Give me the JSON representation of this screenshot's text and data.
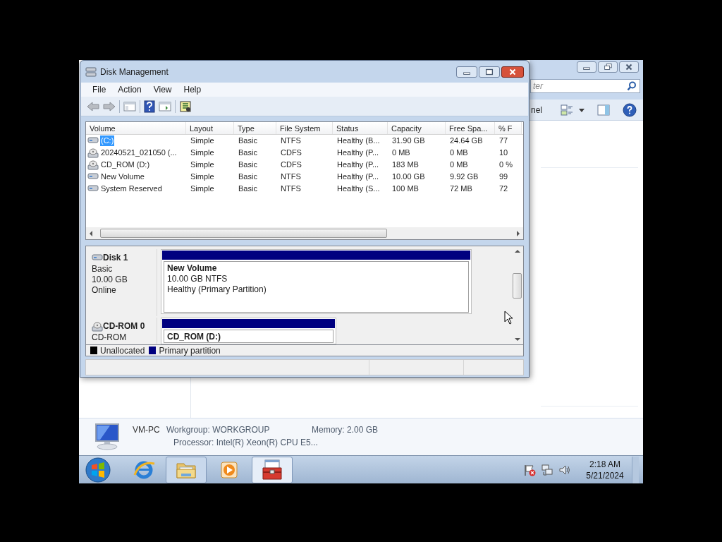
{
  "background_window": {
    "search": {
      "placeholder": "ter"
    },
    "toolbar_label": "nel"
  },
  "window": {
    "title": "Disk Management",
    "menu": [
      "File",
      "Action",
      "View",
      "Help"
    ],
    "volume_list": {
      "columns": [
        "Volume",
        "Layout",
        "Type",
        "File System",
        "Status",
        "Capacity",
        "Free Spa...",
        "% F"
      ],
      "rows": [
        {
          "kind": "disk",
          "selected": true,
          "cells": [
            "(C:)",
            "Simple",
            "Basic",
            "NTFS",
            "Healthy (B...",
            "31.90 GB",
            "24.64 GB",
            "77"
          ]
        },
        {
          "kind": "cd",
          "selected": false,
          "cells": [
            "20240521_021050 (...",
            "Simple",
            "Basic",
            "CDFS",
            "Healthy (P...",
            "0 MB",
            "0 MB",
            "10"
          ]
        },
        {
          "kind": "cd",
          "selected": false,
          "cells": [
            "CD_ROM (D:)",
            "Simple",
            "Basic",
            "CDFS",
            "Healthy (P...",
            "183 MB",
            "0 MB",
            "0 %"
          ]
        },
        {
          "kind": "disk",
          "selected": false,
          "cells": [
            "New Volume",
            "Simple",
            "Basic",
            "NTFS",
            "Healthy (P...",
            "10.00 GB",
            "9.92 GB",
            "99"
          ]
        },
        {
          "kind": "disk",
          "selected": false,
          "cells": [
            "System Reserved",
            "Simple",
            "Basic",
            "NTFS",
            "Healthy (S...",
            "100 MB",
            "72 MB",
            "72"
          ]
        }
      ]
    },
    "disks": [
      {
        "kind": "disk",
        "name": "Disk 1",
        "lines": [
          "Basic",
          "10.00 GB",
          "Online"
        ],
        "partition": {
          "name": "New Volume",
          "lines": [
            "10.00 GB NTFS",
            "Healthy (Primary Partition)"
          ]
        }
      },
      {
        "kind": "cd",
        "name": "CD-ROM 0",
        "lines": [
          "CD-ROM"
        ],
        "partition": {
          "name": "CD_ROM  (D:)"
        }
      }
    ],
    "legend": [
      {
        "label": "Unallocated",
        "color": "#000000"
      },
      {
        "label": "Primary partition",
        "color": "#000080"
      }
    ]
  },
  "details": {
    "computer": "VM-PC",
    "workgroup": "Workgroup: WORKGROUP",
    "memory": "Memory: 2.00 GB",
    "processor": "Processor: Intel(R) Xeon(R) CPU E5..."
  },
  "taskbar": {
    "buttons": [
      {
        "kind": "browser",
        "running": false,
        "selected": false
      },
      {
        "kind": "folder",
        "running": true,
        "selected": false
      },
      {
        "kind": "media",
        "running": false,
        "selected": false
      },
      {
        "kind": "toolbox",
        "running": true,
        "selected": true
      }
    ],
    "clock": {
      "time": "2:18 AM",
      "date": "5/21/2024"
    }
  }
}
